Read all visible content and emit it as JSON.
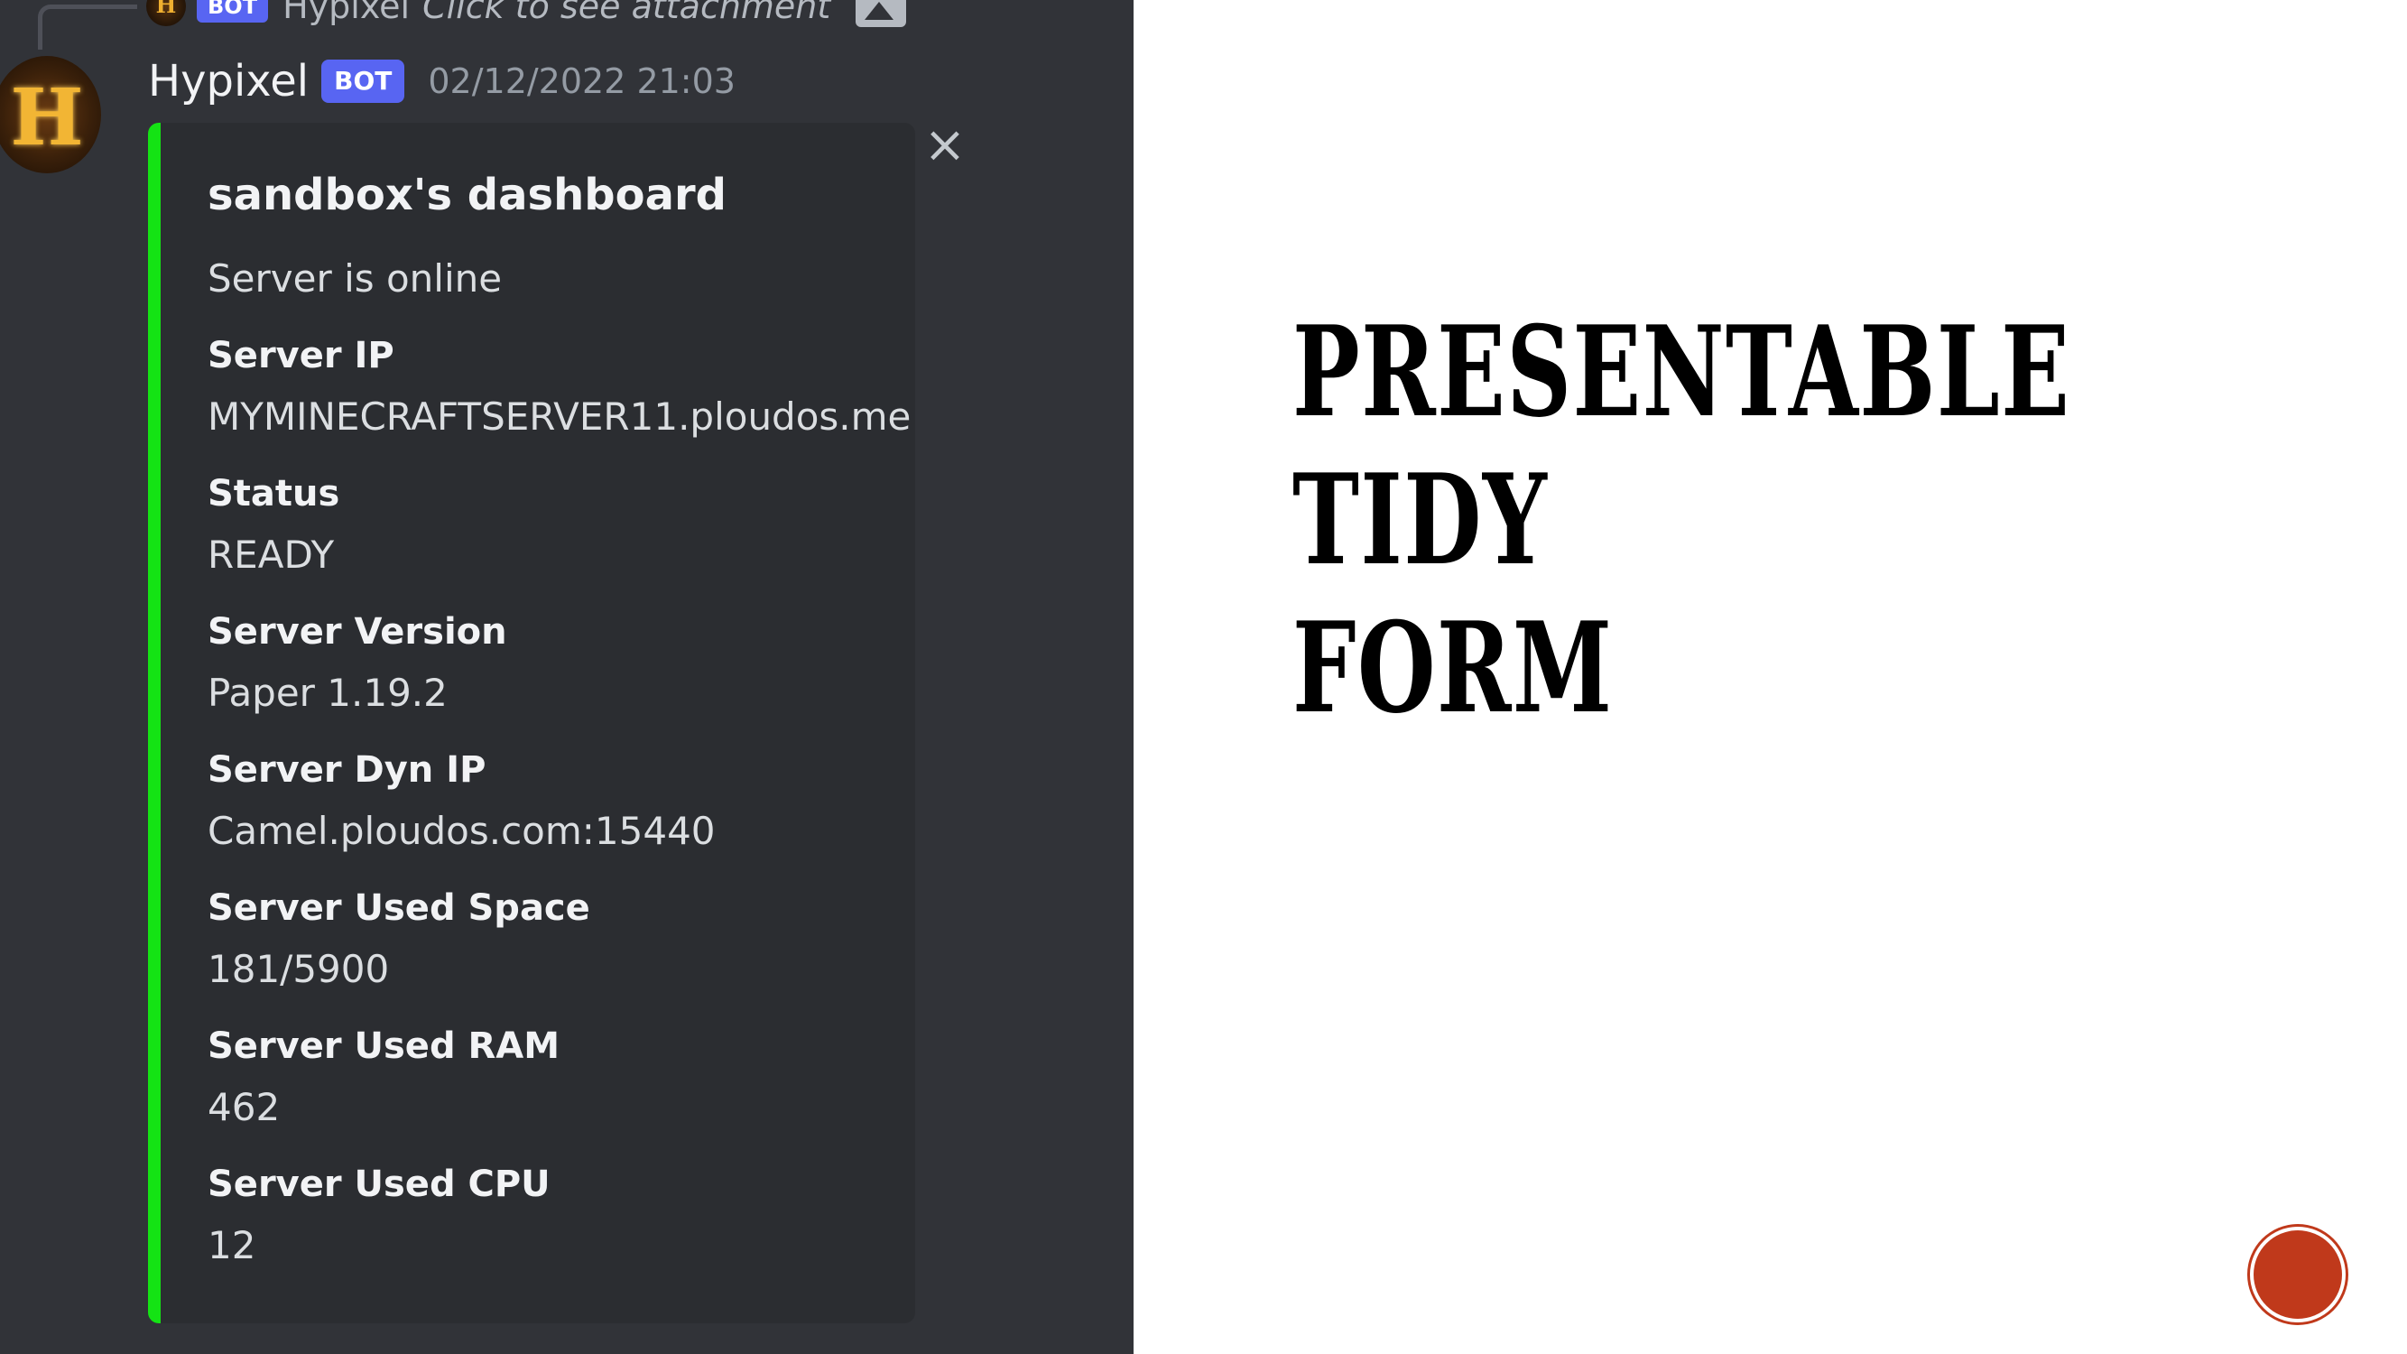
{
  "reply_preview": {
    "avatar_letter": "H",
    "badge": "BOT",
    "name": "Hypixel",
    "text": "Click to see attachment",
    "attachment_icon": "image-icon"
  },
  "message": {
    "avatar_letter": "H",
    "username": "Hypixel",
    "badge": "BOT",
    "timestamp": "02/12/2022 21:03"
  },
  "embed": {
    "accent_color": "#14e314",
    "close_icon": "×",
    "title": "sandbox's dashboard",
    "description": "Server is online",
    "fields": [
      {
        "name": "Server IP",
        "value": "MYMINECRAFTSERVER11.ploudos.me"
      },
      {
        "name": "Status",
        "value": "READY"
      },
      {
        "name": "Server Version",
        "value": "Paper 1.19.2"
      },
      {
        "name": "Server Dyn IP",
        "value": "Camel.ploudos.com:15440"
      },
      {
        "name": "Server Used Space",
        "value": "181/5900"
      },
      {
        "name": "Server Used RAM",
        "value": "462"
      },
      {
        "name": "Server Used CPU",
        "value": "12"
      }
    ]
  },
  "slide": {
    "title_line1": "PRESENTABLE TIDY",
    "title_line2": "FORM",
    "nav_button_color": "#c0391b"
  }
}
